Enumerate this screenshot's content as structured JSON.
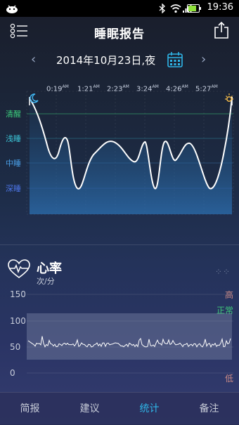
{
  "status_bar": {
    "time": "19:36",
    "icons": [
      "android-icon",
      "bluetooth-icon",
      "wifi-icon",
      "signal-icon",
      "battery-icon"
    ]
  },
  "header": {
    "title": "睡眠报告",
    "menu_icon": "menu-icon",
    "share_icon": "share-icon"
  },
  "date_nav": {
    "date": "2014年10月23日,夜",
    "prev_icon": "chevron-left-icon",
    "next_icon": "chevron-right-icon",
    "calendar_icon": "calendar-icon"
  },
  "sleep_chart": {
    "x_ticks": [
      {
        "time": "0:19",
        "suffix": "AM"
      },
      {
        "time": "1:21",
        "suffix": "AM"
      },
      {
        "time": "2:23",
        "suffix": "AM"
      },
      {
        "time": "3:24",
        "suffix": "AM"
      },
      {
        "time": "4:26",
        "suffix": "AM"
      },
      {
        "time": "5:27",
        "suffix": "AM"
      }
    ],
    "levels": [
      {
        "label": "清醒",
        "color": "#3ccf7d"
      },
      {
        "label": "浅睡",
        "color": "#3cc6d8"
      },
      {
        "label": "中睡",
        "color": "#4a9fe8"
      },
      {
        "label": "深睡",
        "color": "#4d76ea"
      }
    ],
    "start_icon": "moon-icon",
    "end_icon": "sun-icon"
  },
  "heart_rate": {
    "title": "心率",
    "unit": "次/分",
    "icon": "heart-pulse-icon",
    "more_icon": "more-dots-icon",
    "y_ticks": [
      "150",
      "100",
      "50",
      "0"
    ],
    "bands": [
      {
        "label": "高",
        "color": "#c98a86"
      },
      {
        "label": "正常",
        "color": "#3fc97a"
      },
      {
        "label": "低",
        "color": "#c98a86"
      }
    ]
  },
  "tabs": [
    {
      "label": "简报",
      "active": false
    },
    {
      "label": "建议",
      "active": false
    },
    {
      "label": "统计",
      "active": true
    },
    {
      "label": "备注",
      "active": false
    }
  ],
  "colors": {
    "accent": "#2fb6e8",
    "curve": "#ffffff",
    "fill_top": "#2b6fa8"
  }
}
